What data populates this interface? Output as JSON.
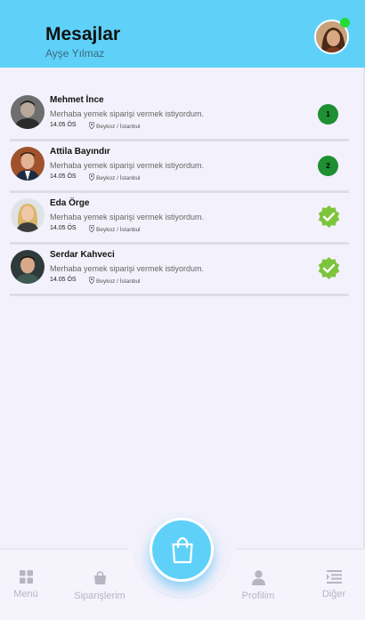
{
  "header": {
    "title": "Mesajlar",
    "subtitle": "Ayşe Yılmaz"
  },
  "messages": [
    {
      "name": "Mehmet İnce",
      "text": "Merhaba yemek siparişi vermek istiyordum.",
      "time": "14.05 ÖS",
      "location": "Beykoz / İstanbul",
      "unread": "1",
      "status": "unread"
    },
    {
      "name": "Attila Bayındır",
      "text": "Merhaba yemek siparişi vermek istiyordum.",
      "time": "14.05 ÖS",
      "location": "Beykoz / İstanbul",
      "unread": "2",
      "status": "unread"
    },
    {
      "name": "Eda Örge",
      "text": "Merhaba yemek siparişi vermek istiyordum.",
      "time": "14.05 ÖS",
      "location": "Beykoz / İstanbul",
      "unread": "",
      "status": "read"
    },
    {
      "name": "Serdar Kahveci",
      "text": "Merhaba yemek siparişi vermek istiyordum.",
      "time": "14.05 ÖS",
      "location": "Beykoz / İstanbul",
      "unread": "",
      "status": "read"
    }
  ],
  "tabs": {
    "menu": "Menü",
    "orders": "Siparişlerim",
    "profile": "Profilim",
    "other": "Diğer"
  },
  "colors": {
    "accent": "#5fd1f9",
    "badge": "#1e8f32",
    "check": "#7cc43a",
    "online": "#22dd33"
  },
  "icons": {
    "fab": "shopping-bag-icon",
    "menu": "grid-icon",
    "orders": "bag-icon",
    "profile": "person-icon",
    "other": "list-indent-icon",
    "read": "check-badge-icon",
    "location": "location-pin-icon"
  }
}
